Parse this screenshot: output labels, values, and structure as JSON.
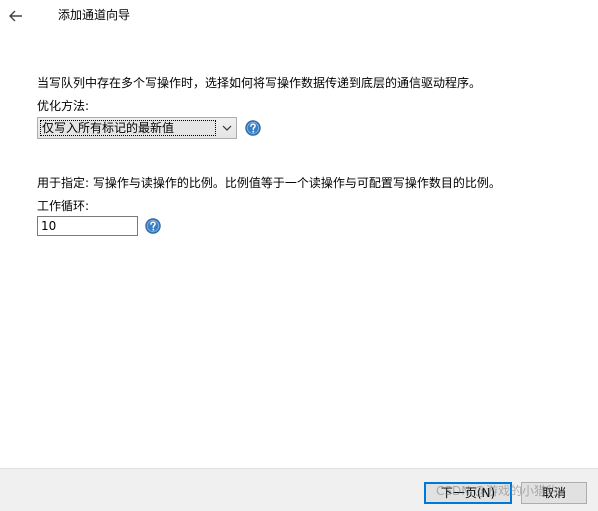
{
  "window": {
    "title": "添加通道向导"
  },
  "write_optimization": {
    "description": "当写队列中存在多个写操作时，选择如何将写操作数据传递到底层的通信驱动程序。",
    "label": "优化方法:",
    "selected_value": "仅写入所有标记的最新值"
  },
  "duty_cycle": {
    "description": "用于指定: 写操作与读操作的比例。比例值等于一个读操作与可配置写操作数目的比例。",
    "label": "工作循环:",
    "value": "10"
  },
  "footer": {
    "next_label": "下一页(N)",
    "cancel_label": "取消"
  },
  "watermark": {
    "text": "CSDN @游戏的小猎豹"
  },
  "colors": {
    "help_icon": "#3c7fc1",
    "primary_border": "#0078d7",
    "footer_bg": "#f0f0f0"
  }
}
